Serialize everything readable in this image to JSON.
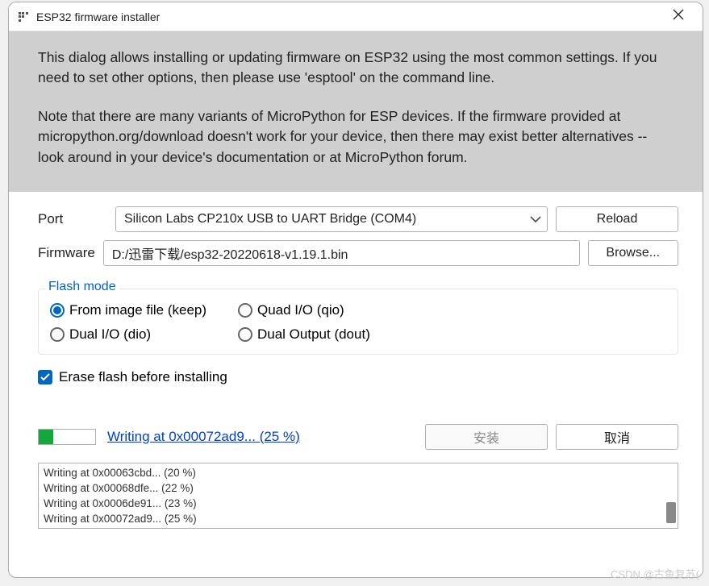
{
  "window": {
    "title": "ESP32 firmware installer"
  },
  "info": {
    "p1": "This dialog allows installing or updating firmware on ESP32 using the most common settings. If you need to set other options, then please use 'esptool' on the command line.",
    "p2": "Note that there are many variants of MicroPython for ESP devices. If the firmware provided at micropython.org/download doesn't work for your device, then there may exist better alternatives -- look around in your device's documentation or at MicroPython forum."
  },
  "form": {
    "port_label": "Port",
    "port_value": "Silicon Labs CP210x USB to UART Bridge (COM4)",
    "reload_btn": "Reload",
    "firmware_label": "Firmware",
    "firmware_value": "D:/迅雷下载/esp32-20220618-v1.19.1.bin",
    "browse_btn": "Browse..."
  },
  "flash": {
    "legend": "Flash mode",
    "options": [
      "From image file (keep)",
      "Quad I/O (qio)",
      "Dual I/O (dio)",
      "Dual Output (dout)"
    ],
    "selected": 0
  },
  "erase": {
    "label": "Erase flash before installing",
    "checked": true
  },
  "progress": {
    "percent": 25,
    "status_link": "Writing at 0x00072ad9... (25 %)",
    "install_btn": "安装",
    "cancel_btn": "取消"
  },
  "log_lines": [
    "Writing at 0x00063cbd... (20 %)",
    "Writing at 0x00068dfe... (22 %)",
    "Writing at 0x0006de91... (23 %)",
    "Writing at 0x00072ad9... (25 %)"
  ],
  "watermark": "CSDN @古鱼复苏("
}
